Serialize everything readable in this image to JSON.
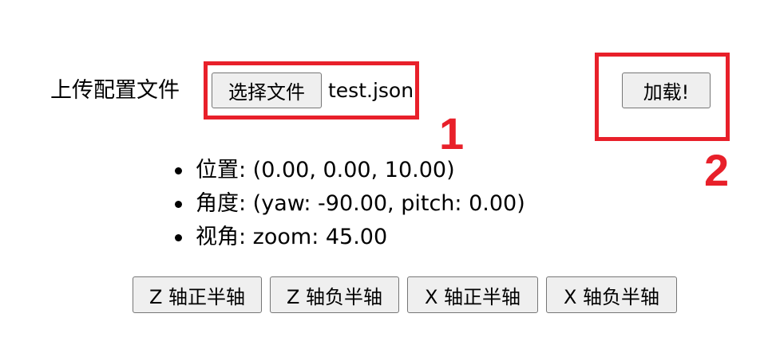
{
  "upload": {
    "label": "上传配置文件",
    "choose_button": "选择文件",
    "file_name": "test.json",
    "load_button": "加载!"
  },
  "annotations": {
    "box1_number": "1",
    "box2_number": "2",
    "color": "#e8202a"
  },
  "info": {
    "items": [
      "位置: (0.00, 0.00, 10.00)",
      "角度: (yaw: -90.00, pitch: 0.00)",
      "视角: zoom: 45.00"
    ]
  },
  "axis_buttons": [
    "Z 轴正半轴",
    "Z 轴负半轴",
    "X 轴正半轴",
    "X 轴负半轴"
  ]
}
